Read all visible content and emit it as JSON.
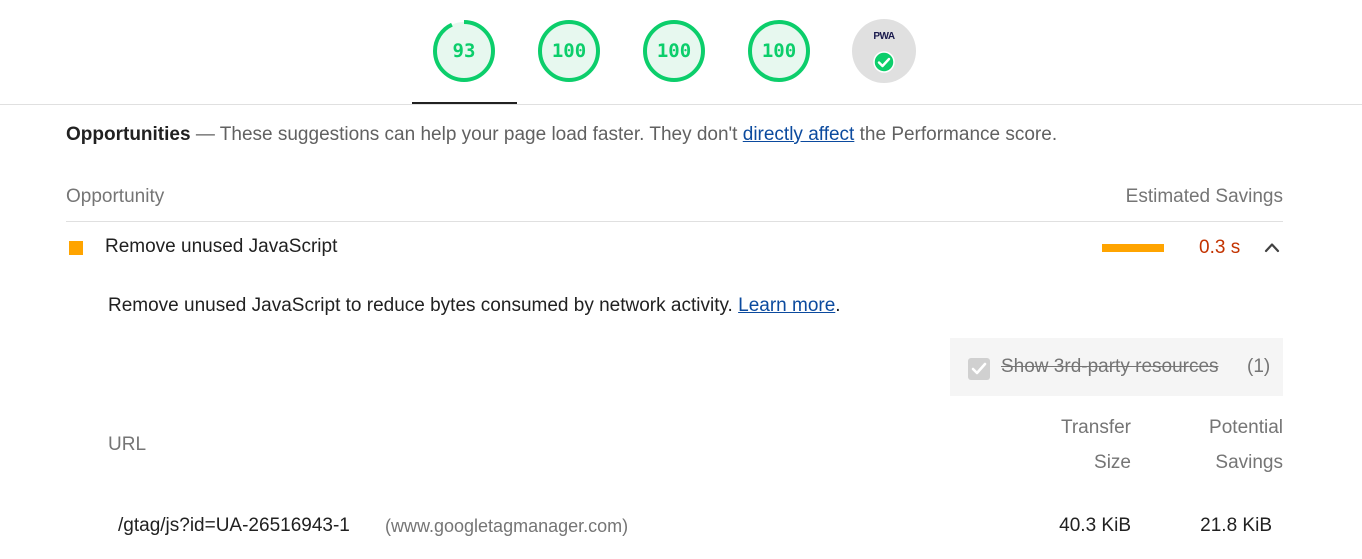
{
  "gauges": [
    {
      "name": "performance",
      "value": "93",
      "score": 0.93
    },
    {
      "name": "accessibility",
      "value": "100",
      "score": 1.0
    },
    {
      "name": "best-practices",
      "value": "100",
      "score": 1.0
    },
    {
      "name": "seo",
      "value": "100",
      "score": 1.0
    }
  ],
  "pwa": {
    "label": "PWA",
    "status": "check-icon"
  },
  "colors": {
    "pass": "#0cce6b",
    "average": "#ffa400",
    "link": "#0b4a9e",
    "savings": "#c33300"
  },
  "opportunities": {
    "title": "Opportunities",
    "dash": " — ",
    "text_before": "These suggestions can help your page load faster. They don't ",
    "link": "directly affect",
    "text_after": " the Performance score."
  },
  "columns": {
    "opportunity": "Opportunity",
    "estimated_savings": "Estimated Savings"
  },
  "audit": {
    "title": "Remove unused JavaScript",
    "savings": "0.3 s",
    "savings_bar_fraction": 1.0,
    "description_before": "Remove unused JavaScript to reduce bytes consumed by network activity. ",
    "description_link": "Learn more",
    "description_after": ".",
    "filter": {
      "label": "Show 3rd-party resources",
      "count": "(1)",
      "checked": true
    }
  },
  "table": {
    "headers": {
      "url": "URL",
      "transfer_1": "Transfer",
      "transfer_2": "Size",
      "potential_1": "Potential",
      "potential_2": "Savings"
    },
    "rows": [
      {
        "url": "/gtag/js?id=UA-26516943-1",
        "host": "(www.googletagmanager.com)",
        "transfer": "40.3 KiB",
        "potential": "21.8 KiB"
      }
    ]
  }
}
